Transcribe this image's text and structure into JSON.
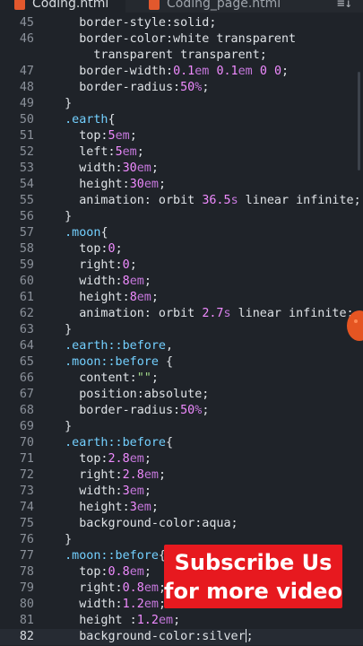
{
  "tabs": [
    {
      "label": "Coding.html",
      "active": true,
      "icon": "html-file-icon"
    },
    {
      "label": "Coding_page.html",
      "active": false,
      "icon": "html-file-icon"
    }
  ],
  "tab_actions_label": "≡↓",
  "lines": [
    {
      "n": "45",
      "code": "    border-style:solid;"
    },
    {
      "n": "46",
      "code": "    border-color:white transparent"
    },
    {
      "n": "",
      "code": "      transparent transparent;"
    },
    {
      "n": "47",
      "code": "    border-width:0.1em 0.1em 0 0;"
    },
    {
      "n": "48",
      "code": "    border-radius:50%;"
    },
    {
      "n": "49",
      "code": "  }"
    },
    {
      "n": "50",
      "code": "  .earth{"
    },
    {
      "n": "51",
      "code": "    top:5em;"
    },
    {
      "n": "52",
      "code": "    left:5em;"
    },
    {
      "n": "53",
      "code": "    width:30em;"
    },
    {
      "n": "54",
      "code": "    height:30em;"
    },
    {
      "n": "55",
      "code": "    animation: orbit 36.5s linear infinite;"
    },
    {
      "n": "56",
      "code": "  }"
    },
    {
      "n": "57",
      "code": "  .moon{"
    },
    {
      "n": "58",
      "code": "    top:0;"
    },
    {
      "n": "59",
      "code": "    right:0;"
    },
    {
      "n": "60",
      "code": "    width:8em;"
    },
    {
      "n": "61",
      "code": "    height:8em;"
    },
    {
      "n": "62",
      "code": "    animation: orbit 2.7s linear infinite;"
    },
    {
      "n": "63",
      "code": "  }"
    },
    {
      "n": "64",
      "code": "  .earth::before,"
    },
    {
      "n": "65",
      "code": "  .moon::before {"
    },
    {
      "n": "66",
      "code": "    content:\"\";"
    },
    {
      "n": "67",
      "code": "    position:absolute;"
    },
    {
      "n": "68",
      "code": "    border-radius:50%;"
    },
    {
      "n": "69",
      "code": "  }"
    },
    {
      "n": "70",
      "code": "  .earth::before{"
    },
    {
      "n": "71",
      "code": "    top:2.8em;"
    },
    {
      "n": "72",
      "code": "    right:2.8em;"
    },
    {
      "n": "73",
      "code": "    width:3em;"
    },
    {
      "n": "74",
      "code": "    height:3em;"
    },
    {
      "n": "75",
      "code": "    background-color:aqua;"
    },
    {
      "n": "76",
      "code": "  }"
    },
    {
      "n": "77",
      "code": "  .moon::before{"
    },
    {
      "n": "78",
      "code": "    top:0.8em;"
    },
    {
      "n": "79",
      "code": "    right:0.8em;"
    },
    {
      "n": "80",
      "code": "    width:1.2em;"
    },
    {
      "n": "81",
      "code": "    height :1.2em;"
    },
    {
      "n": "82",
      "code": "    background-color:silver;",
      "current": true
    }
  ],
  "overlay": {
    "line1": "Subscribe Us",
    "line2": "for more video",
    "color": "#e7191f"
  }
}
